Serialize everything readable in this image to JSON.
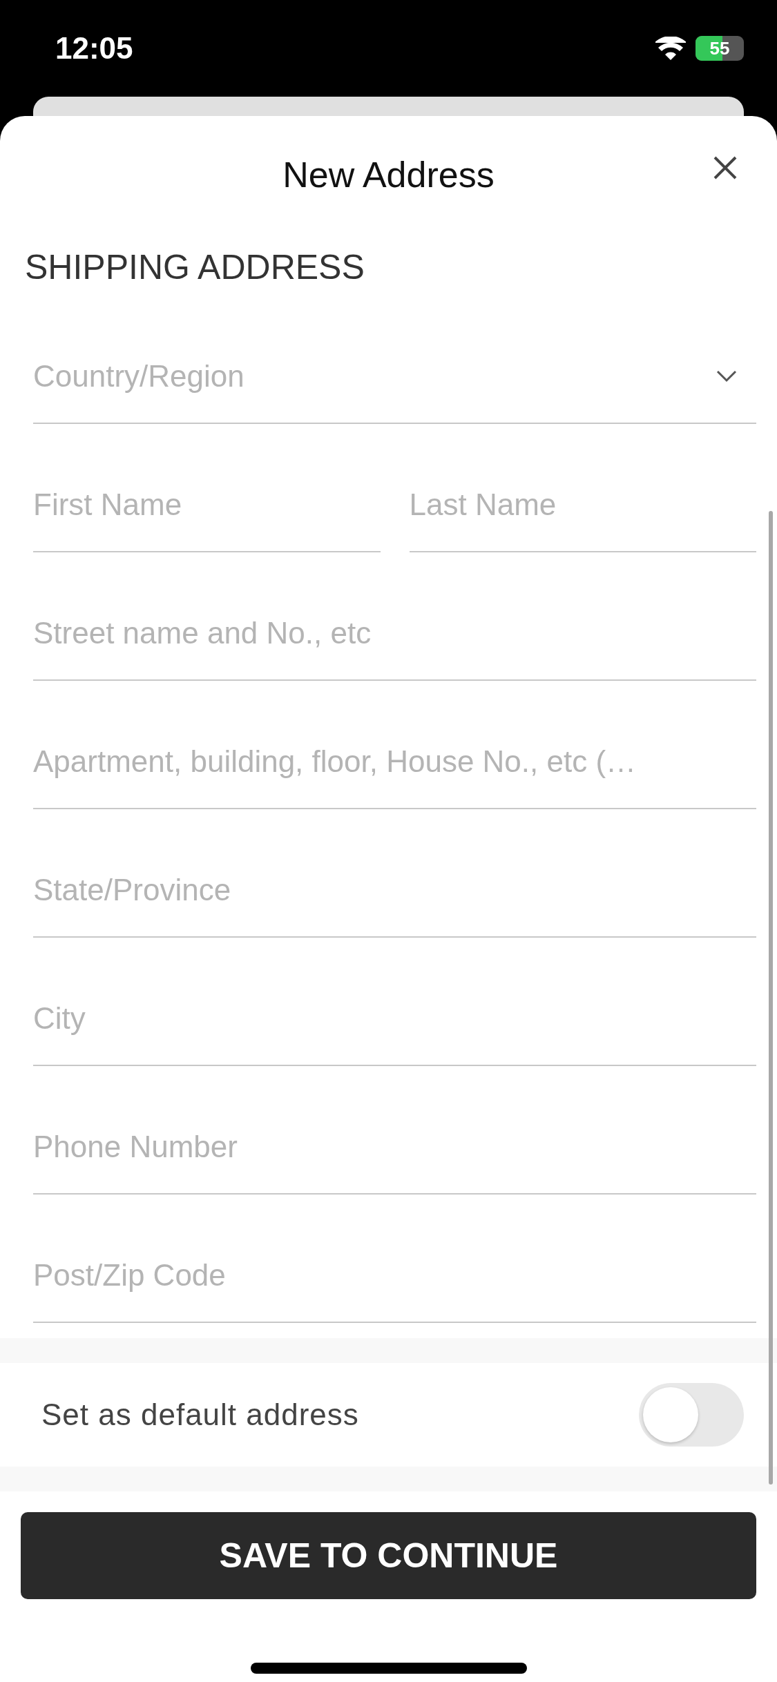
{
  "status_bar": {
    "time": "12:05",
    "battery": "55"
  },
  "sheet": {
    "title": "New Address",
    "section": "SHIPPING ADDRESS"
  },
  "rows": [
    {
      "fields": [
        {
          "kind": "select",
          "placeholder": "Country/Region"
        }
      ]
    },
    {
      "fields": [
        {
          "kind": "text",
          "placeholder": "First Name"
        },
        {
          "kind": "text",
          "placeholder": "Last Name"
        }
      ]
    },
    {
      "fields": [
        {
          "kind": "text",
          "placeholder": "Street name and No., etc"
        }
      ]
    },
    {
      "fields": [
        {
          "kind": "text",
          "placeholder": "Apartment, building, floor, House No., etc (…"
        }
      ]
    },
    {
      "fields": [
        {
          "kind": "text",
          "placeholder": "State/Province"
        }
      ]
    },
    {
      "fields": [
        {
          "kind": "text",
          "placeholder": "City"
        }
      ]
    },
    {
      "fields": [
        {
          "kind": "text",
          "placeholder": "Phone Number"
        }
      ]
    },
    {
      "fields": [
        {
          "kind": "text",
          "placeholder": "Post/Zip Code"
        }
      ]
    }
  ],
  "default_toggle": {
    "label": "Set as default address",
    "on": false
  },
  "save_button": "SAVE TO CONTINUE"
}
